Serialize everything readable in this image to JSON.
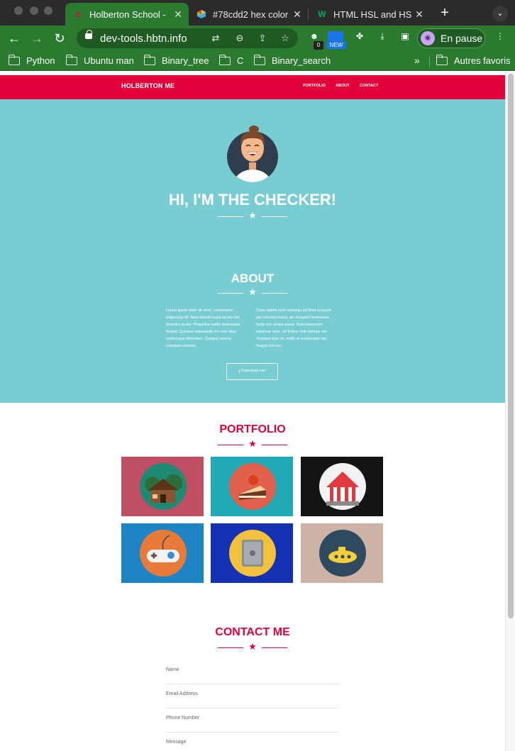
{
  "browser": {
    "tabs": [
      {
        "title": "Holberton School -",
        "active": true
      },
      {
        "title": "#78cdd2 hex color",
        "active": false
      },
      {
        "title": "HTML HSL and HS",
        "active": false
      }
    ],
    "url": "dev-tools.hbtn.info",
    "profile_label": "En pause",
    "ext_badge_count": "0",
    "ext_badge_new": "NEW",
    "bookmarks": [
      "Python",
      "Ubuntu man",
      "Binary_tree",
      "C",
      "Binary_search"
    ],
    "bookmarks_more": "»",
    "other_bookmarks": "Autres favoris"
  },
  "site": {
    "brand": "HOLBERTON ME",
    "nav": [
      "PORTFOLIO",
      "ABOUT",
      "CONTACT"
    ],
    "hero_title": "HI, I'M THE CHECKER!",
    "about_title": "ABOUT",
    "about_left": "Lorem ipsum dolor sit amet, consectetur adipiscing elit. Nam blandit turpis iaculis nisl pharetra auctor. Phasellus mattis malesuada feugiat. Quisque malesuada orci non risus scelerisque bibendum. Quisque viverra vulputate posuere.",
    "about_right": "Class aptent taciti sociosqu ad litora torquent per conubia nostra, per inceptos himenaeos. Nulla non ornare purus. Nulla bibendum maximus urna, vel finibus velit tristique vel. Vivamus ante mi, mollis at scelerisque nec, feugiat non dui.",
    "download_label": "Download me!",
    "portfolio_title": "PORTFOLIO",
    "contact_title": "CONTACT ME",
    "fields": [
      "Name",
      "Email Address",
      "Phone Number",
      "Message"
    ]
  },
  "colors": {
    "brand_red": "#e1003a",
    "hero_teal": "#78cdd2",
    "tiles": [
      "#c04e64",
      "#21a9b6",
      "#141414",
      "#1e84c4",
      "#1431b4",
      "#cdb3a6"
    ]
  },
  "icons": {
    "portfolio": [
      "cabin-icon",
      "cake-icon",
      "circus-tent-icon",
      "game-controller-icon",
      "safe-icon",
      "submarine-icon"
    ]
  }
}
